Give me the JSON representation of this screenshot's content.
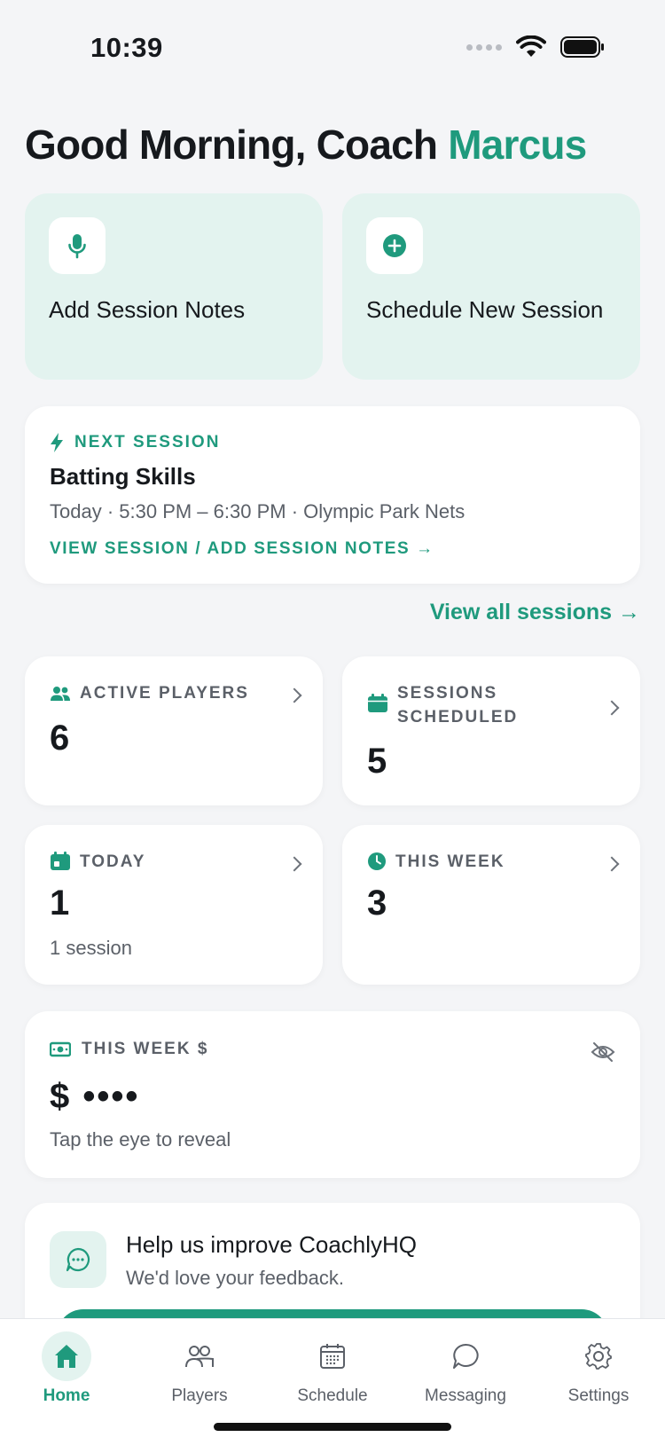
{
  "status_bar": {
    "time": "10:39"
  },
  "greeting": {
    "prefix": "Good Morning, Coach ",
    "name": "Marcus"
  },
  "quick_actions": [
    {
      "label": "Add Session Notes",
      "icon": "microphone-icon"
    },
    {
      "label": "Schedule New Session",
      "icon": "plus-circle-icon"
    }
  ],
  "next_session": {
    "eyebrow": "NEXT SESSION",
    "title": "Batting Skills",
    "details": "Today · 5:30 PM – 6:30 PM · Olympic Park Nets",
    "link": "VIEW SESSION / ADD SESSION NOTES →"
  },
  "view_all_sessions": "View all sessions →",
  "stats": {
    "active_players": {
      "label": "ACTIVE PLAYERS",
      "value": "6",
      "icon": "users-icon"
    },
    "sessions_scheduled": {
      "label_line1": "SESSIONS",
      "label_line2": "SCHEDULED",
      "value": "5",
      "icon": "calendar-icon"
    },
    "today": {
      "label": "TODAY",
      "value": "1",
      "sub": "1 session",
      "icon": "calendar-today-icon"
    },
    "this_week": {
      "label": "THIS WEEK",
      "value": "3",
      "icon": "clock-icon"
    }
  },
  "earnings": {
    "label": "THIS WEEK $",
    "value": "$ ••••",
    "sub": "Tap the eye to reveal",
    "icon": "money-icon"
  },
  "feedback": {
    "title": "Help us improve CoachlyHQ",
    "subtitle": "We'd love your feedback."
  },
  "tabs": [
    {
      "label": "Home",
      "icon": "home-icon",
      "active": true
    },
    {
      "label": "Players",
      "icon": "players-icon",
      "active": false
    },
    {
      "label": "Schedule",
      "icon": "schedule-icon",
      "active": false
    },
    {
      "label": "Messaging",
      "icon": "chat-icon",
      "active": false
    },
    {
      "label": "Settings",
      "icon": "gear-icon",
      "active": false
    }
  ],
  "colors": {
    "accent": "#1f9a7d",
    "accent_light": "#e3f3ef",
    "background": "#f4f5f7"
  }
}
